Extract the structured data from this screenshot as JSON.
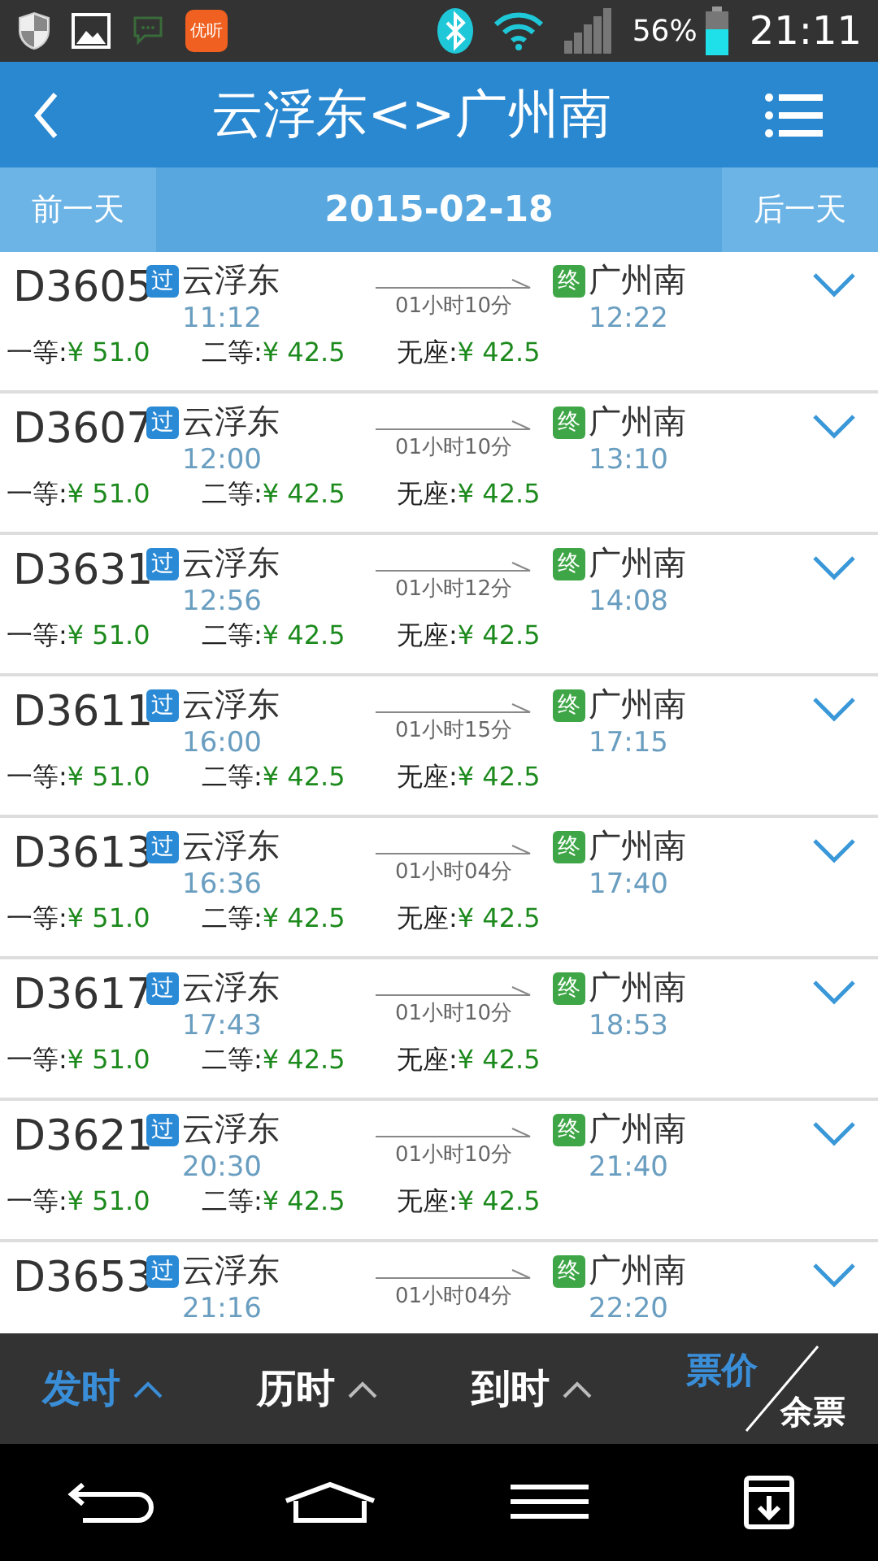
{
  "status_bar": {
    "app_badge": "优听",
    "battery": "56%",
    "time": "21:11"
  },
  "header": {
    "title": "云浮东<>广州南"
  },
  "date_bar": {
    "prev": "前一天",
    "date": "2015-02-18",
    "next": "后一天"
  },
  "trains": [
    {
      "train": "D3605",
      "from_badge": "过",
      "from": "云浮东",
      "depart": "11:12",
      "duration": "01小时10分",
      "to_badge": "终",
      "to": "广州南",
      "arrive": "12:22",
      "prices": [
        {
          "label": "一等:",
          "value": "¥ 51.0"
        },
        {
          "label": "二等:",
          "value": "¥ 42.5"
        },
        {
          "label": "无座:",
          "value": "¥ 42.5"
        }
      ]
    },
    {
      "train": "D3607",
      "from_badge": "过",
      "from": "云浮东",
      "depart": "12:00",
      "duration": "01小时10分",
      "to_badge": "终",
      "to": "广州南",
      "arrive": "13:10",
      "prices": [
        {
          "label": "一等:",
          "value": "¥ 51.0"
        },
        {
          "label": "二等:",
          "value": "¥ 42.5"
        },
        {
          "label": "无座:",
          "value": "¥ 42.5"
        }
      ]
    },
    {
      "train": "D3631",
      "from_badge": "过",
      "from": "云浮东",
      "depart": "12:56",
      "duration": "01小时12分",
      "to_badge": "终",
      "to": "广州南",
      "arrive": "14:08",
      "prices": [
        {
          "label": "一等:",
          "value": "¥ 51.0"
        },
        {
          "label": "二等:",
          "value": "¥ 42.5"
        },
        {
          "label": "无座:",
          "value": "¥ 42.5"
        }
      ]
    },
    {
      "train": "D3611",
      "from_badge": "过",
      "from": "云浮东",
      "depart": "16:00",
      "duration": "01小时15分",
      "to_badge": "终",
      "to": "广州南",
      "arrive": "17:15",
      "prices": [
        {
          "label": "一等:",
          "value": "¥ 51.0"
        },
        {
          "label": "二等:",
          "value": "¥ 42.5"
        },
        {
          "label": "无座:",
          "value": "¥ 42.5"
        }
      ]
    },
    {
      "train": "D3613",
      "from_badge": "过",
      "from": "云浮东",
      "depart": "16:36",
      "duration": "01小时04分",
      "to_badge": "终",
      "to": "广州南",
      "arrive": "17:40",
      "prices": [
        {
          "label": "一等:",
          "value": "¥ 51.0"
        },
        {
          "label": "二等:",
          "value": "¥ 42.5"
        },
        {
          "label": "无座:",
          "value": "¥ 42.5"
        }
      ]
    },
    {
      "train": "D3617",
      "from_badge": "过",
      "from": "云浮东",
      "depart": "17:43",
      "duration": "01小时10分",
      "to_badge": "终",
      "to": "广州南",
      "arrive": "18:53",
      "prices": [
        {
          "label": "一等:",
          "value": "¥ 51.0"
        },
        {
          "label": "二等:",
          "value": "¥ 42.5"
        },
        {
          "label": "无座:",
          "value": "¥ 42.5"
        }
      ]
    },
    {
      "train": "D3621",
      "from_badge": "过",
      "from": "云浮东",
      "depart": "20:30",
      "duration": "01小时10分",
      "to_badge": "终",
      "to": "广州南",
      "arrive": "21:40",
      "prices": [
        {
          "label": "一等:",
          "value": "¥ 51.0"
        },
        {
          "label": "二等:",
          "value": "¥ 42.5"
        },
        {
          "label": "无座:",
          "value": "¥ 42.5"
        }
      ]
    },
    {
      "train": "D3653",
      "from_badge": "过",
      "from": "云浮东",
      "depart": "21:16",
      "duration": "01小时04分",
      "to_badge": "终",
      "to": "广州南",
      "arrive": "22:20"
    }
  ],
  "sort_bar": [
    {
      "kind": "sort",
      "label": "发时",
      "selected": true
    },
    {
      "kind": "sort",
      "label": "历时",
      "selected": false
    },
    {
      "kind": "sort",
      "label": "到时",
      "selected": false
    },
    {
      "kind": "split",
      "upper": "票价",
      "lower": "余票",
      "upper_selected": true,
      "lower_selected": false
    }
  ]
}
